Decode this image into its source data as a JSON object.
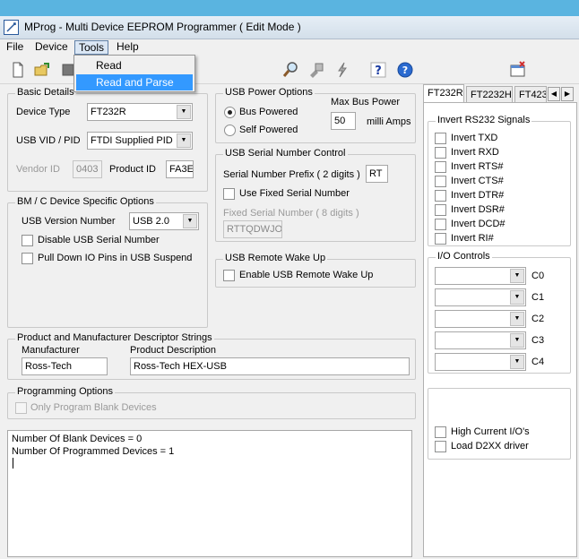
{
  "window": {
    "title": "MProg - Multi Device EEPROM Programmer ( Edit Mode )"
  },
  "menu": {
    "file": "File",
    "device": "Device",
    "tools": "Tools",
    "help": "Help"
  },
  "tools_menu": {
    "items": [
      "Read",
      "Read and Parse"
    ],
    "highlighted": "Read and Parse"
  },
  "basic": {
    "title": "Basic Details",
    "device_type_label": "Device Type",
    "device_type": "FT232R",
    "vidpid_label": "USB VID / PID",
    "vidpid": "FTDI Supplied PID",
    "vendor_id_label": "Vendor ID",
    "vendor_id": "0403",
    "product_id_label": "Product ID",
    "product_id": "FA3E"
  },
  "bmc": {
    "title": "BM / C Device Specific Options",
    "usb_version_label": "USB Version Number",
    "usb_version": "USB 2.0",
    "disable_serial": "Disable USB Serial Number",
    "pulldown": "Pull Down IO Pins in USB Suspend"
  },
  "power": {
    "title": "USB Power Options",
    "bus_powered": "Bus Powered",
    "self_powered": "Self Powered",
    "max_bus_power_label": "Max Bus Power",
    "max_bus_power": "50",
    "unit": "milli Amps"
  },
  "serial": {
    "title": "USB Serial Number Control",
    "prefix_label": "Serial Number Prefix ( 2 digits )",
    "prefix": "RT",
    "use_fixed": "Use Fixed Serial Number",
    "fixed_label": "Fixed Serial Number ( 8 digits )",
    "fixed": "RTTQDWJO"
  },
  "wake": {
    "title": "USB Remote Wake Up",
    "enable": "Enable USB Remote Wake Up"
  },
  "desc": {
    "title": "Product and Manufacturer Descriptor Strings",
    "manufacturer_label": "Manufacturer",
    "manufacturer": "Ross-Tech",
    "product_label": "Product Description",
    "product": "Ross-Tech HEX-USB"
  },
  "prog": {
    "title": "Programming Options",
    "only_blank": "Only Program Blank Devices"
  },
  "log": {
    "lines": [
      "Number Of Blank Devices = 0",
      "Number Of Programmed Devices = 1"
    ]
  },
  "tabs": [
    "FT232R",
    "FT2232H",
    "FT423"
  ],
  "invert": {
    "title": "Invert RS232 Signals",
    "items": [
      "Invert TXD",
      "Invert RXD",
      "Invert RTS#",
      "Invert CTS#",
      "Invert DTR#",
      "Invert DSR#",
      "Invert DCD#",
      "Invert RI#"
    ]
  },
  "io": {
    "title": "I/O Controls",
    "labels": [
      "C0",
      "C1",
      "C2",
      "C3",
      "C4"
    ]
  },
  "misc": {
    "high_current": "High Current I/O's",
    "load_d2xx": "Load D2XX driver"
  }
}
